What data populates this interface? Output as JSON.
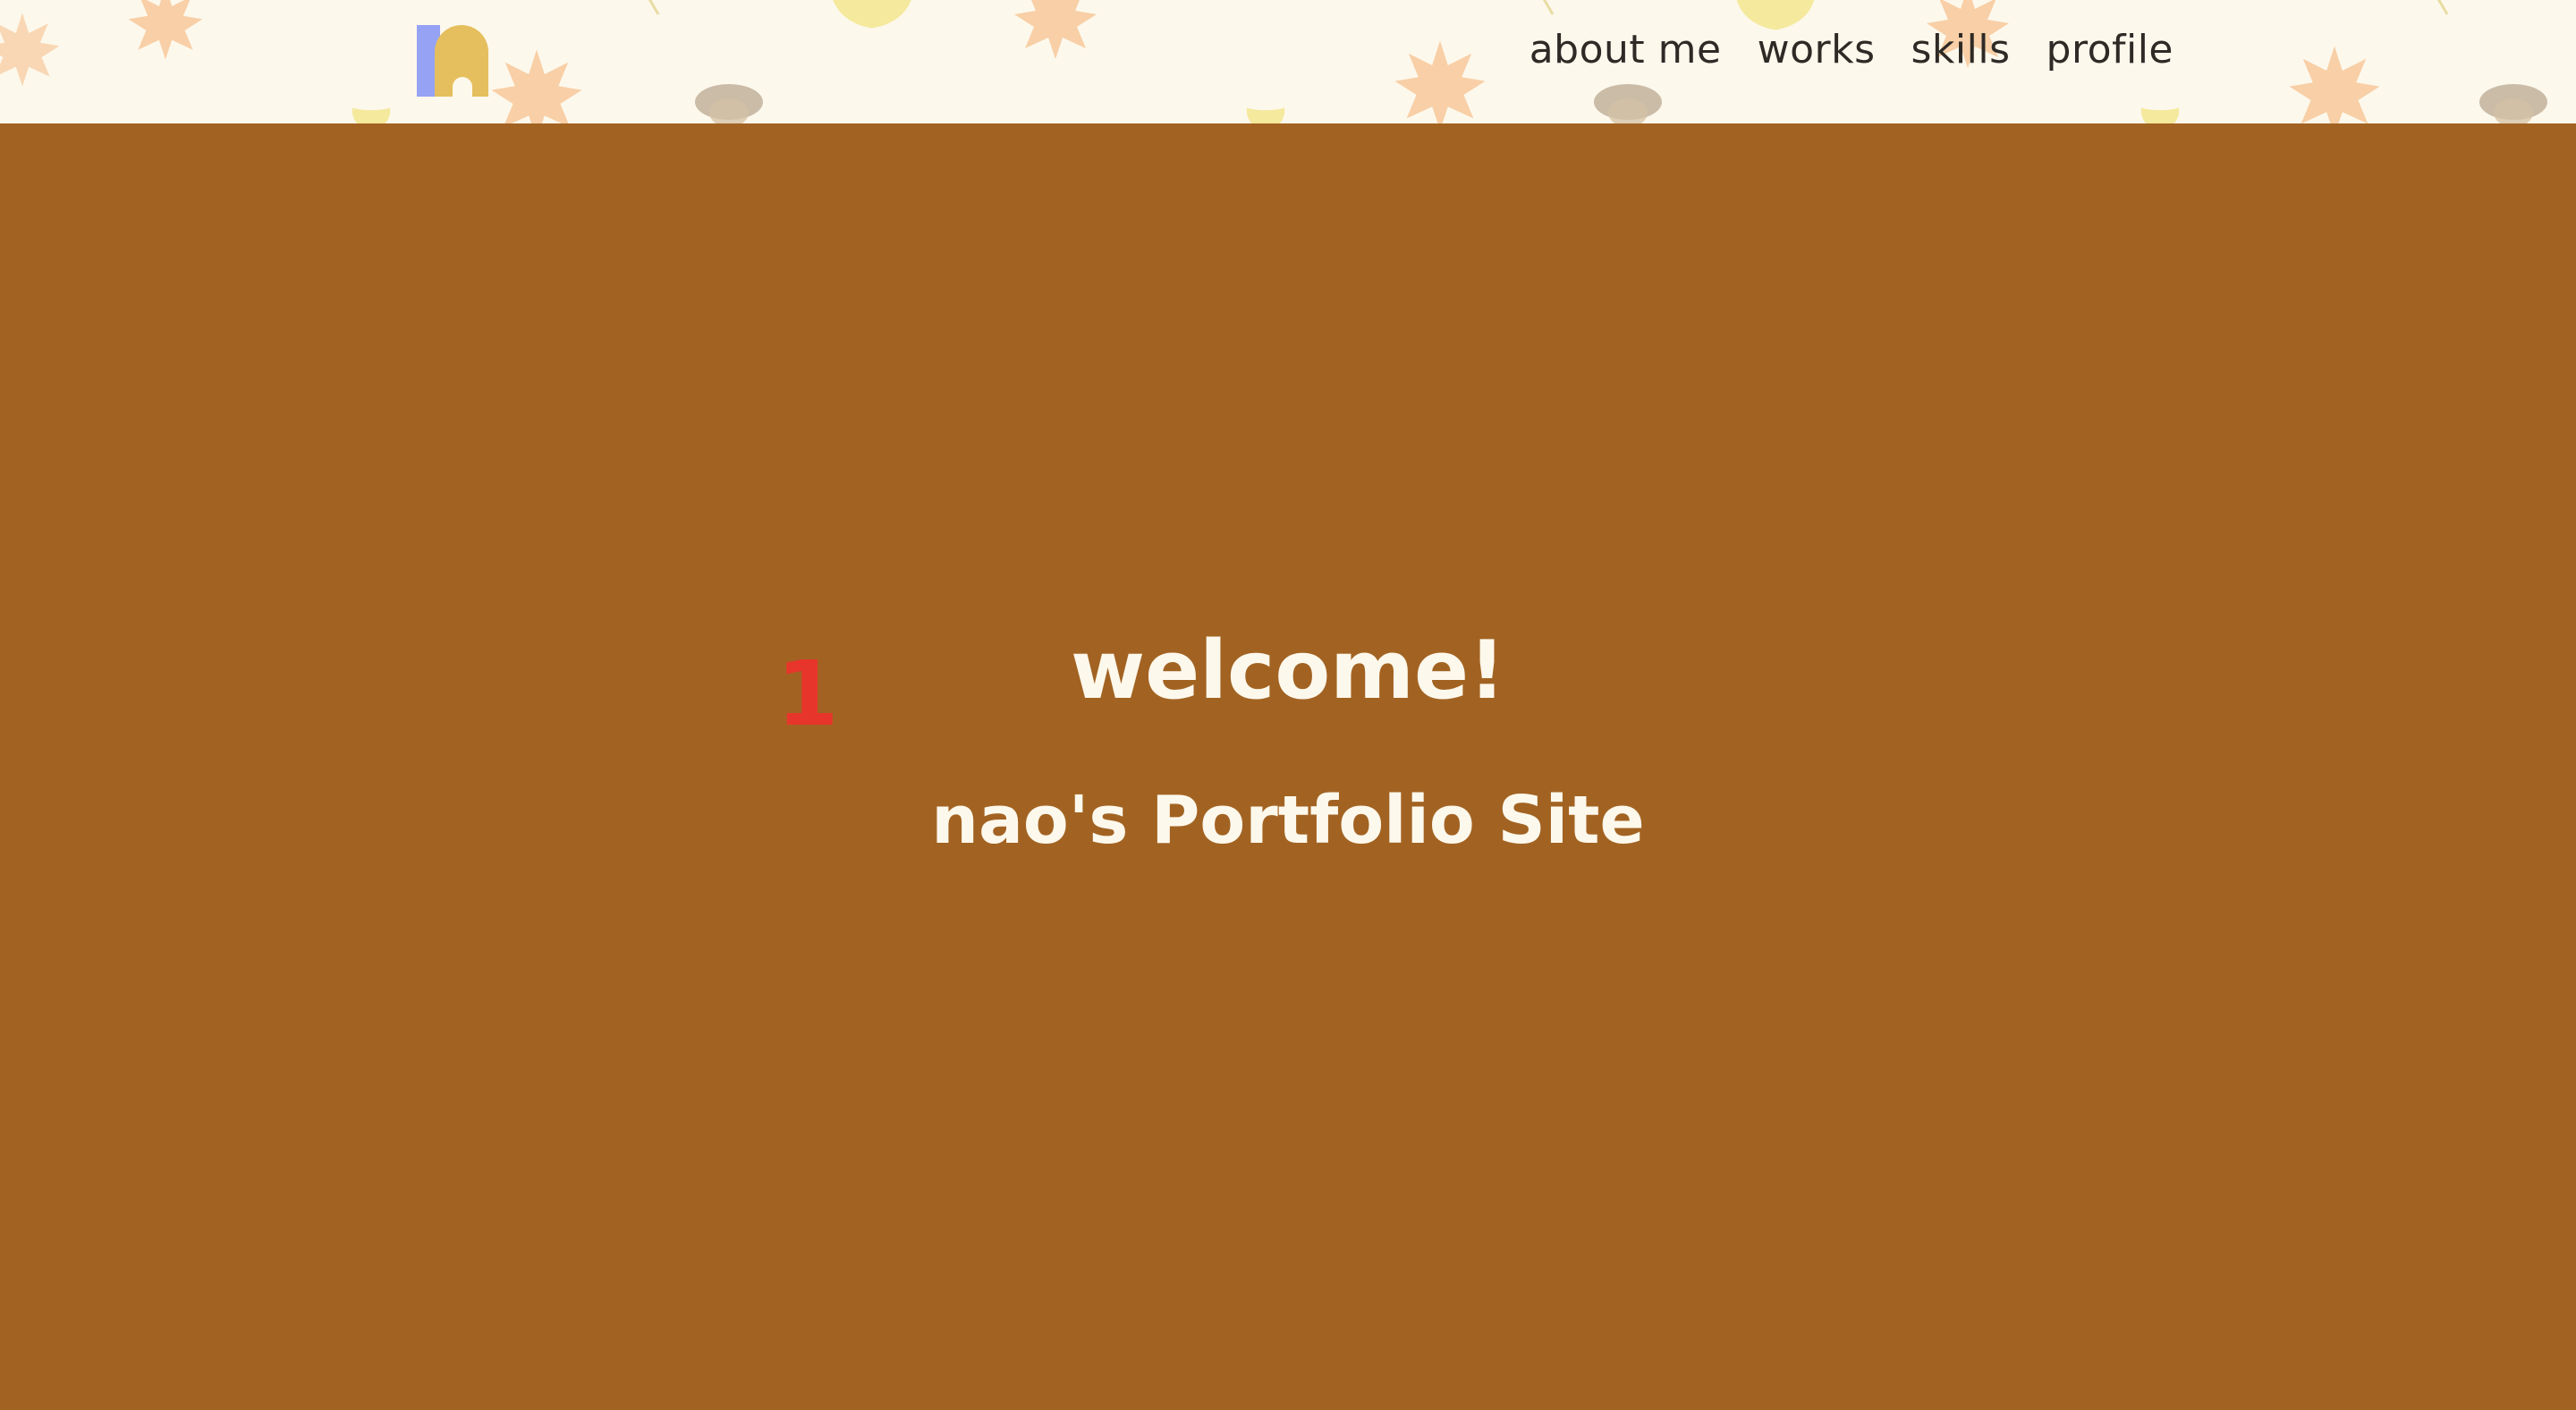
{
  "header": {
    "logo_alt": "n",
    "nav": [
      {
        "label": "about me"
      },
      {
        "label": "works"
      },
      {
        "label": "skills"
      },
      {
        "label": "profile"
      }
    ]
  },
  "hero": {
    "title": "welcome!",
    "subtitle": "nao's Portfolio Site",
    "marker": "1"
  },
  "colors": {
    "header_bg": "#fdf8ec",
    "hero_bg": "#a26322",
    "hero_text": "#fdf8ec",
    "nav_text": "#2e2a26",
    "marker": "#e8352c",
    "logo_bar": "#96a2f3",
    "logo_arch": "#e5bf5d"
  }
}
